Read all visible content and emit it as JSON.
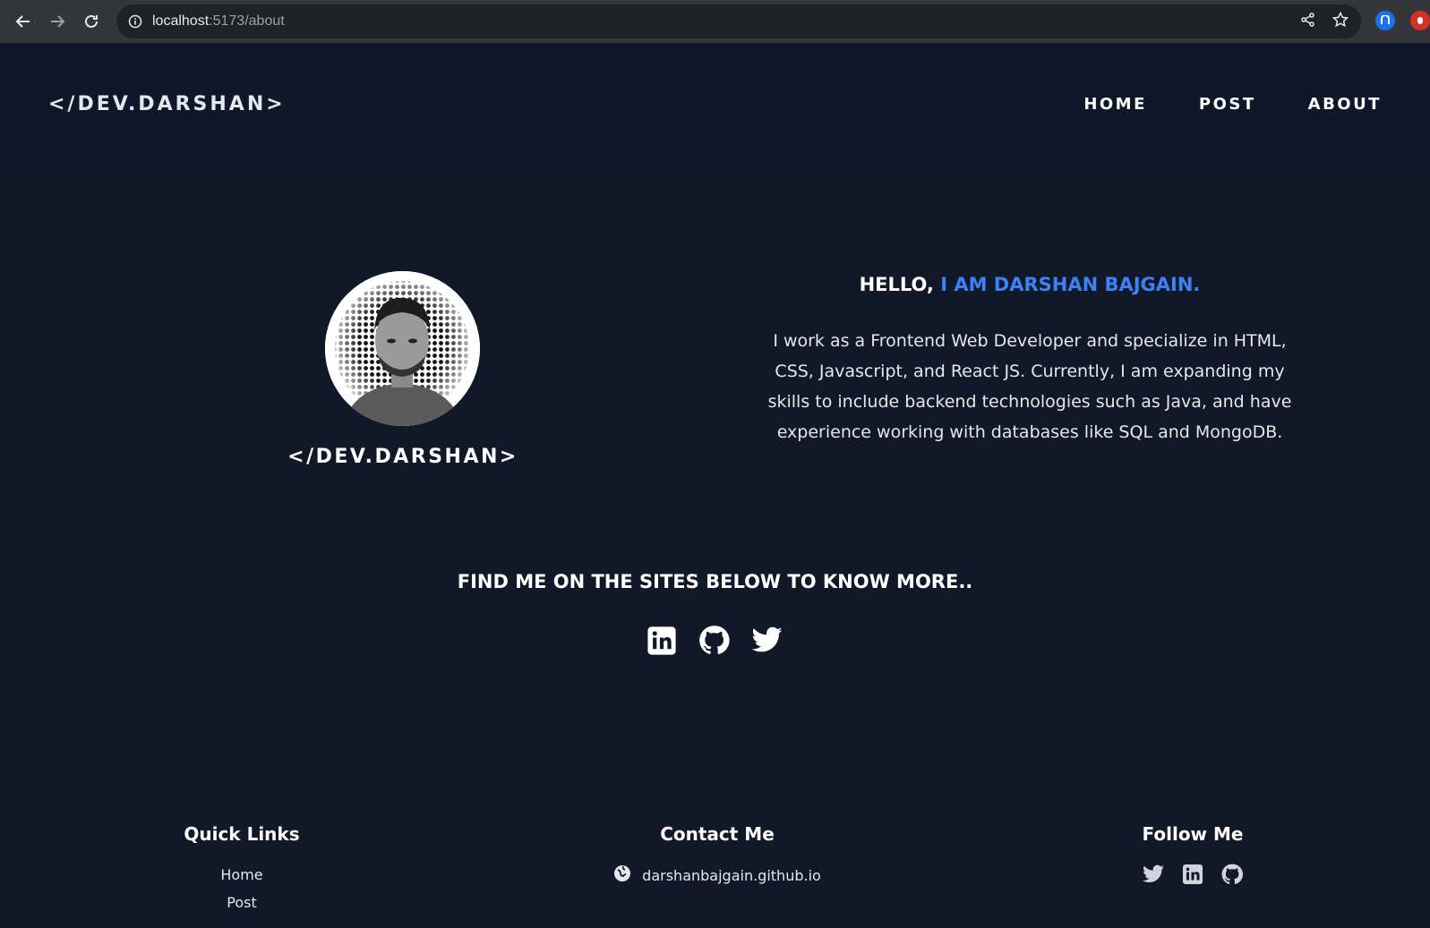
{
  "browser": {
    "url_host": "localhost",
    "url_path": ":5173/about",
    "icons": [
      "back-arrow-icon",
      "forward-arrow-icon",
      "reload-icon",
      "info-icon",
      "share-icon",
      "star-icon"
    ]
  },
  "header": {
    "logo": "</DEV.DARSHAN>",
    "nav": [
      "HOME",
      "POST",
      "ABOUT"
    ]
  },
  "hero": {
    "name": "</DEV.DARSHAN>",
    "hello_prefix": "HELLO, ",
    "hello_name": "I AM DARSHAN BAJGAIN.",
    "bio": "I work as a Frontend Web Developer and specialize in HTML, CSS, Javascript, and React JS. Currently, I am expanding my skills to include backend technologies such as Java, and have experience working with databases like SQL and MongoDB."
  },
  "find": {
    "title": "FIND ME ON THE SITES BELOW TO KNOW MORE..",
    "icons": [
      "linkedin-icon",
      "github-icon",
      "twitter-icon"
    ]
  },
  "footer": {
    "quick_links_title": "Quick Links",
    "quick_links": [
      "Home",
      "Post"
    ],
    "contact_title": "Contact Me",
    "contact_site": "darshanbajgain.github.io",
    "follow_title": "Follow Me"
  },
  "colors": {
    "background": "#111827",
    "header": "#0f172a",
    "accent": "#3b82f6",
    "chrome": "#35363a"
  }
}
